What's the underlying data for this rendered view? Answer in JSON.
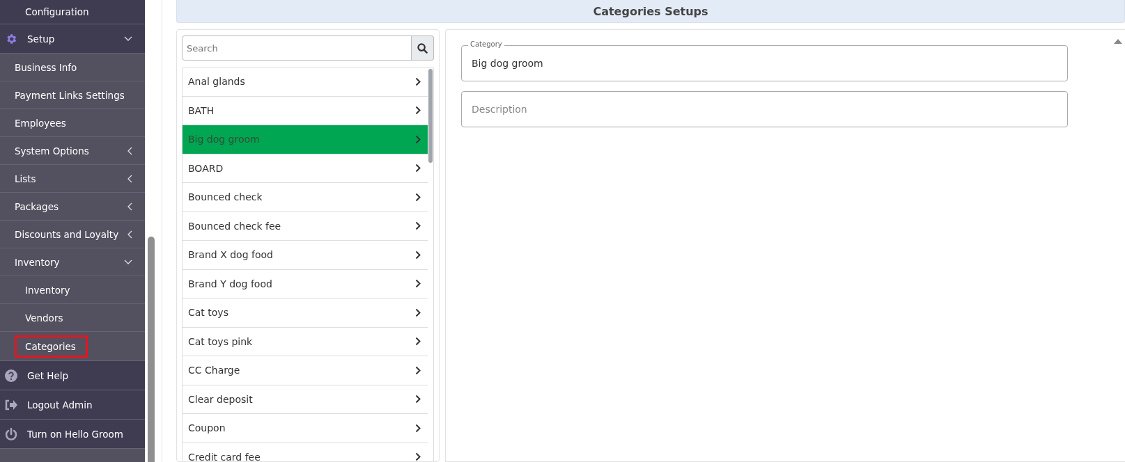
{
  "sidebar": {
    "items": [
      {
        "kind": "nested-link",
        "label": "Configuration"
      },
      {
        "kind": "section",
        "label": "Setup",
        "expanded": true,
        "children": [
          {
            "label": "Business Info"
          },
          {
            "label": "Payment Links Settings"
          },
          {
            "label": "Employees"
          },
          {
            "label": "System Options",
            "expanded": false
          },
          {
            "label": "Lists",
            "expanded": false
          },
          {
            "label": "Packages",
            "expanded": false
          },
          {
            "label": "Discounts and Loyalty",
            "expanded": false
          },
          {
            "label": "Inventory",
            "expanded": true,
            "children": [
              {
                "label": "Inventory",
                "highlighted": false
              },
              {
                "label": "Vendors",
                "highlighted": false
              },
              {
                "label": "Categories",
                "highlighted": true
              }
            ]
          }
        ]
      },
      {
        "kind": "section",
        "label": "Get Help"
      },
      {
        "kind": "section",
        "label": "Logout Admin"
      },
      {
        "kind": "section",
        "label": "Turn on Hello Groom"
      }
    ]
  },
  "header": {
    "title": "Categories Setups"
  },
  "search": {
    "placeholder": "Search"
  },
  "categories": [
    {
      "label": "Anal glands",
      "selected": false
    },
    {
      "label": "BATH",
      "selected": false
    },
    {
      "label": "Big dog groom",
      "selected": true
    },
    {
      "label": "BOARD",
      "selected": false
    },
    {
      "label": "Bounced check",
      "selected": false
    },
    {
      "label": "Bounced check fee",
      "selected": false
    },
    {
      "label": "Brand X dog food",
      "selected": false
    },
    {
      "label": "Brand Y dog food",
      "selected": false
    },
    {
      "label": "Cat toys",
      "selected": false
    },
    {
      "label": "Cat toys pink",
      "selected": false
    },
    {
      "label": "CC Charge",
      "selected": false
    },
    {
      "label": "Clear deposit",
      "selected": false
    },
    {
      "label": "Coupon",
      "selected": false
    },
    {
      "label": "Credit card fee",
      "selected": false
    }
  ],
  "form": {
    "category": {
      "label": "Category",
      "value": "Big dog groom"
    },
    "description": {
      "placeholder": "Description"
    }
  }
}
